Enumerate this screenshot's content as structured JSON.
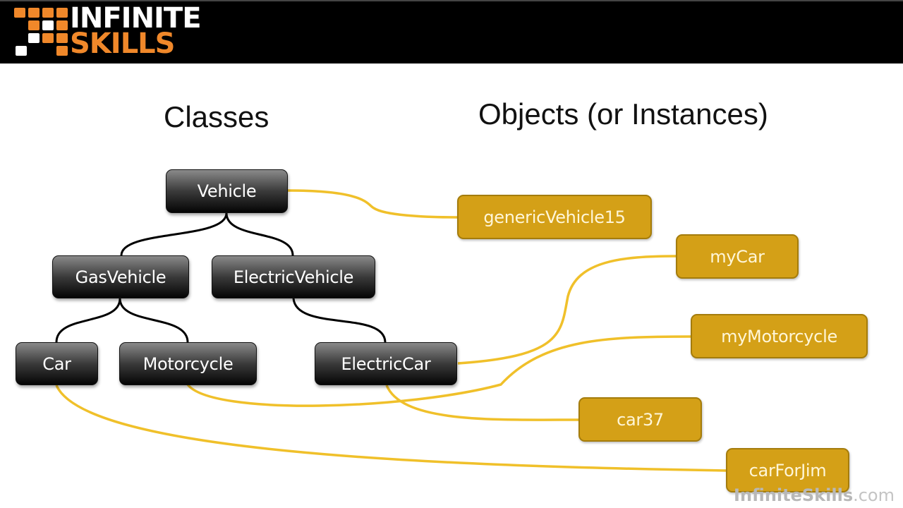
{
  "brand": {
    "logo_line1": "INFINITE",
    "logo_line2": "SKILLS",
    "watermark_bold": "InfiniteSkills",
    "watermark_suffix": ".com",
    "colors": {
      "orange": "#f0882a",
      "white": "#ffffff",
      "header_bg": "#000000"
    }
  },
  "headings": {
    "classes": "Classes",
    "objects": "Objects (or Instances)"
  },
  "classes": [
    {
      "id": "vehicle",
      "label": "Vehicle",
      "parent": null
    },
    {
      "id": "gasvehicle",
      "label": "GasVehicle",
      "parent": "vehicle"
    },
    {
      "id": "electricvehicle",
      "label": "ElectricVehicle",
      "parent": "vehicle"
    },
    {
      "id": "car",
      "label": "Car",
      "parent": "gasvehicle"
    },
    {
      "id": "motorcycle",
      "label": "Motorcycle",
      "parent": "gasvehicle"
    },
    {
      "id": "electriccar",
      "label": "ElectricCar",
      "parent": "electricvehicle"
    }
  ],
  "objects": [
    {
      "id": "genericvehicle15",
      "label": "genericVehicle15",
      "class": "vehicle"
    },
    {
      "id": "mycar",
      "label": "myCar",
      "class": "electriccar"
    },
    {
      "id": "mymotorcycle",
      "label": "myMotorcycle",
      "class": "motorcycle"
    },
    {
      "id": "car37",
      "label": "car37",
      "class": "electriccar"
    },
    {
      "id": "carforjim",
      "label": "carForJim",
      "class": "car"
    }
  ],
  "colors": {
    "class_box": "#1a1a1a",
    "object_box": "#d4a017",
    "object_border": "#a47c0c",
    "inheritance_line": "#000000",
    "instance_line": "#f0c02a"
  }
}
